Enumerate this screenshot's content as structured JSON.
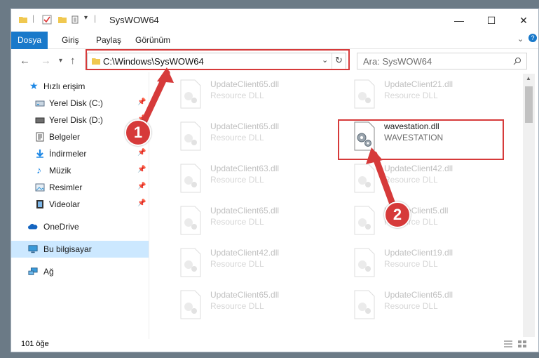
{
  "window": {
    "title": "SysWOW64",
    "controls": {
      "minimize": "—",
      "maximize": "☐",
      "close": "✕"
    }
  },
  "ribbon": {
    "tabs": [
      "Dosya",
      "Giriş",
      "Paylaş",
      "Görünüm"
    ]
  },
  "navigation": {
    "address": "C:\\Windows\\SysWOW64",
    "search_placeholder": "Ara: SysWOW64"
  },
  "sidebar": {
    "items": [
      {
        "label": "Hızlı erişim",
        "icon": "star-icon",
        "pinned": false
      },
      {
        "label": "Yerel Disk (C:)",
        "icon": "drive-icon",
        "pinned": true
      },
      {
        "label": "Yerel Disk (D:)",
        "icon": "drive-icon",
        "pinned": true
      },
      {
        "label": "Belgeler",
        "icon": "document-icon",
        "pinned": true
      },
      {
        "label": "İndirmeler",
        "icon": "download-icon",
        "pinned": true
      },
      {
        "label": "Müzik",
        "icon": "music-icon",
        "pinned": true
      },
      {
        "label": "Resimler",
        "icon": "picture-icon",
        "pinned": true
      },
      {
        "label": "Videolar",
        "icon": "video-icon",
        "pinned": true
      },
      {
        "label": "OneDrive",
        "icon": "cloud-icon",
        "pinned": false
      },
      {
        "label": "Bu bilgisayar",
        "icon": "computer-icon",
        "pinned": false,
        "selected": true
      },
      {
        "label": "Ağ",
        "icon": "network-icon",
        "pinned": false
      }
    ]
  },
  "files": [
    {
      "name": "UpdateClient65.dll",
      "type": "Resource DLL"
    },
    {
      "name": "UpdateClient21.dll",
      "type": "Resource DLL"
    },
    {
      "name": "UpdateClient65.dll",
      "type": "Resource DLL"
    },
    {
      "name": "wavestation.dll",
      "type": "WAVESTATION",
      "highlighted": true
    },
    {
      "name": "UpdateClient63.dll",
      "type": "Resource DLL"
    },
    {
      "name": "UpdateClient42.dll",
      "type": "Resource DLL"
    },
    {
      "name": "UpdateClient65.dll",
      "type": "Resource DLL"
    },
    {
      "name": "UpdateClient5.dll",
      "type": "Resource DLL"
    },
    {
      "name": "UpdateClient42.dll",
      "type": "Resource DLL"
    },
    {
      "name": "UpdateClient19.dll",
      "type": "Resource DLL"
    },
    {
      "name": "UpdateClient65.dll",
      "type": "Resource DLL"
    },
    {
      "name": "UpdateClient65.dll",
      "type": "Resource DLL"
    }
  ],
  "status": {
    "count": "101 öğe"
  },
  "annotations": {
    "step1": "1",
    "step2": "2",
    "color": "#d63a3a"
  }
}
